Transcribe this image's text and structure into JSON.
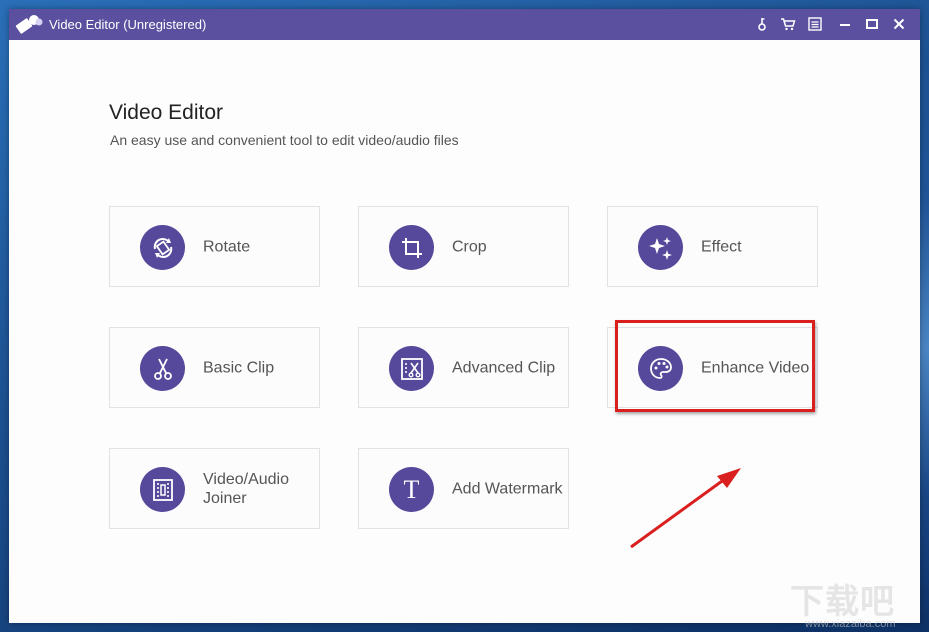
{
  "window": {
    "title": "Video Editor (Unregistered)"
  },
  "titlebar_icons": [
    "key-icon",
    "cart-icon",
    "menu-icon",
    "minimize-icon",
    "maximize-icon",
    "close-icon"
  ],
  "main": {
    "heading": "Video Editor",
    "subtitle": "An easy use and convenient tool to edit video/audio files"
  },
  "tools": [
    {
      "label": "Rotate",
      "icon": "rotate-icon"
    },
    {
      "label": "Crop",
      "icon": "crop-icon"
    },
    {
      "label": "Effect",
      "icon": "effect-icon"
    },
    {
      "label": "Basic Clip",
      "icon": "scissors-icon"
    },
    {
      "label": "Advanced Clip",
      "icon": "advanced-clip-icon"
    },
    {
      "label": "Enhance Video",
      "icon": "palette-icon"
    },
    {
      "label": "Video/Audio Joiner",
      "icon": "joiner-icon"
    },
    {
      "label": "Add Watermark",
      "icon": "text-icon"
    }
  ],
  "annotation": {
    "highlight_color": "#d9201f",
    "highlighted_tool": "Enhance Video"
  },
  "colors": {
    "titlebar": "#5b4f9f",
    "icon_circle": "#56489a"
  }
}
